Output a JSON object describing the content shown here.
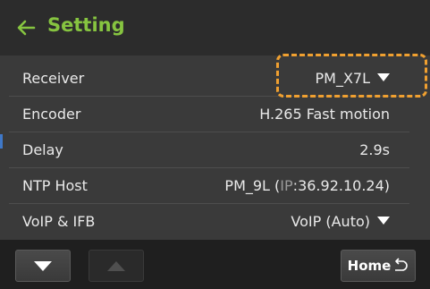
{
  "header": {
    "title": "Setting",
    "back_icon": "arrow-left-icon",
    "accent_color": "#86c440"
  },
  "settings": [
    {
      "label": "Receiver",
      "value": "PM_X7L",
      "has_dropdown": true
    },
    {
      "label": "Encoder",
      "value": "H.265 Fast motion",
      "has_dropdown": false
    },
    {
      "label": "Delay",
      "value": "2.9s",
      "has_dropdown": false
    },
    {
      "label": "NTP Host",
      "value_host": "PM_9L (",
      "value_ip_label": "IP",
      "value_ip": ":36.92.10.24)",
      "has_dropdown": false
    },
    {
      "label": "VoIP & IFB",
      "value": "VoIP (Auto)",
      "has_dropdown": true
    }
  ],
  "highlight_color": "#f0a030",
  "footer": {
    "down_icon": "triangle-down-icon",
    "up_icon": "triangle-up-icon",
    "home_label": "Home",
    "home_icon": "return-icon"
  }
}
